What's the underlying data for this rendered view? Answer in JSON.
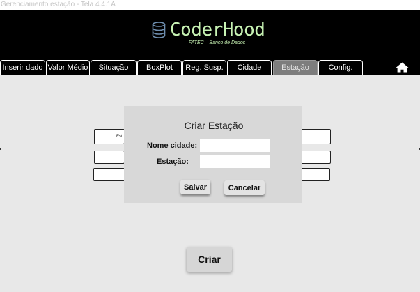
{
  "window": {
    "title": "Gerenciamento estação - Tela 4.4.1A"
  },
  "header": {
    "logo_text": "CoderHood",
    "logo_subtitle": "FATEC – Banco de Dados",
    "logo_icon": "database-icon",
    "logo_color": "#c7f2b3"
  },
  "tabs": [
    {
      "label": "Inserir dado",
      "active": false
    },
    {
      "label": "Valor Médio",
      "active": false
    },
    {
      "label": "Situação",
      "active": false
    },
    {
      "label": "BoxPlot",
      "active": false
    },
    {
      "label": "Reg. Susp.",
      "active": false
    },
    {
      "label": "Cidade",
      "active": false
    },
    {
      "label": "Estação",
      "active": true
    },
    {
      "label": "Config.",
      "active": false
    }
  ],
  "home_icon": "home-icon",
  "background_form": {
    "partial_label": "Est"
  },
  "modal": {
    "title": "Criar Estação",
    "fields": [
      {
        "label": "Nome cidade:",
        "value": "",
        "placeholder": ""
      },
      {
        "label": "Estação:",
        "value": "",
        "placeholder": ""
      }
    ],
    "save_label": "Salvar",
    "cancel_label": "Cancelar"
  },
  "create_label": "Criar"
}
